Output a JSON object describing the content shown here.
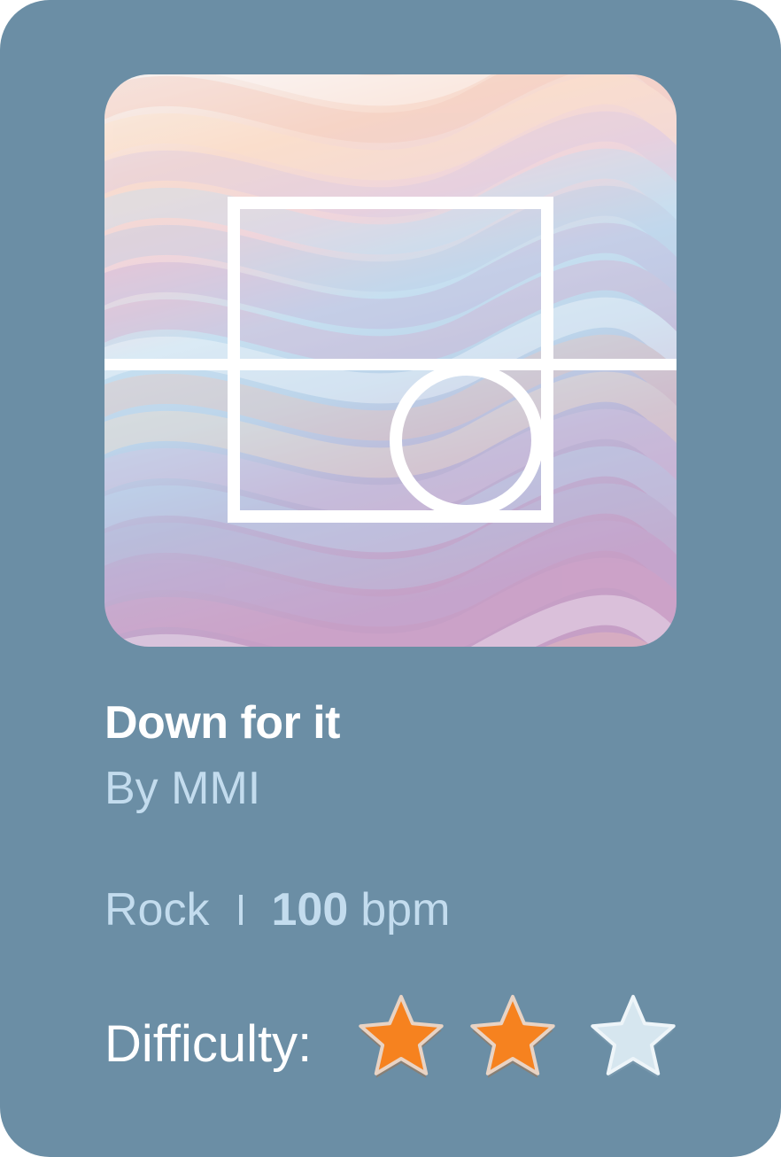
{
  "song": {
    "title": "Down for it",
    "artist": "By MMI",
    "genre": "Rock",
    "bpm_value": "100",
    "bpm_unit": "bpm"
  },
  "difficulty": {
    "label": "Difficulty:",
    "rating": 2,
    "max": 3
  },
  "colors": {
    "card_background": "#6b8ea5",
    "star_filled": "#f6821f",
    "star_empty": "#d6e6ef",
    "secondary_text": "#c3dcee"
  },
  "icons": {
    "cover_art": "square-circle-crosshair-art",
    "star": "star-icon"
  }
}
